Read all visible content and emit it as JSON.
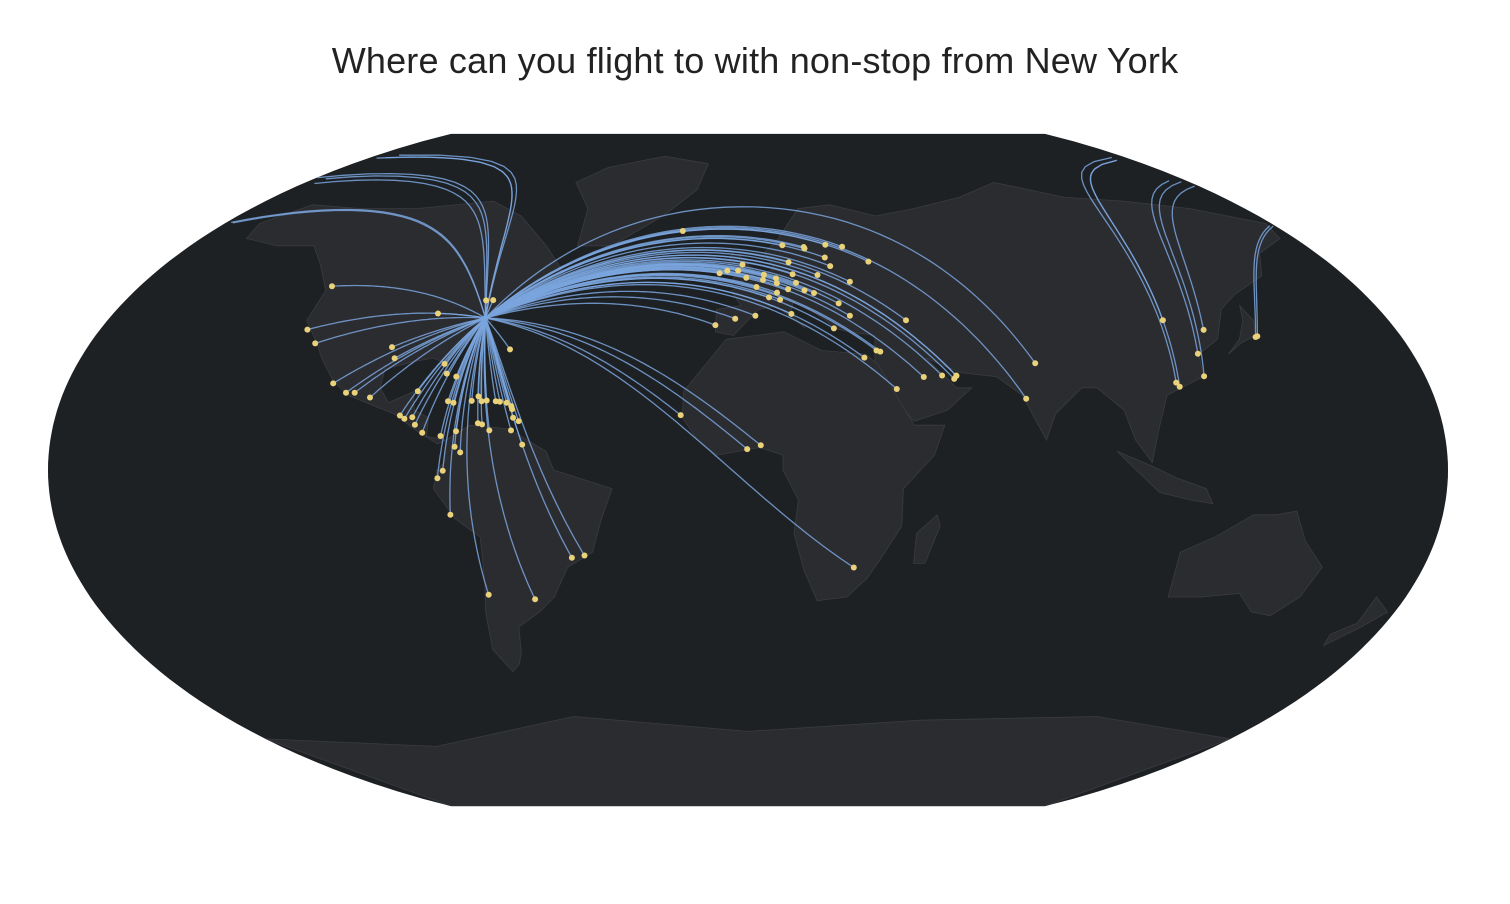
{
  "title": "Where can you flight to with non-stop from New York",
  "colors": {
    "background": "#ffffff",
    "ocean": "#1e2124",
    "land": "#2b2c30",
    "border": "#3a3b40",
    "route": "#7aa4dd",
    "destination": "#e9d27a",
    "title": "#222222"
  },
  "origin": {
    "lon": -74.0,
    "lat": 40.7
  },
  "destinations": [
    [
      -122.4,
      37.6
    ],
    [
      -118.4,
      33.9
    ],
    [
      -123.1,
      49.2
    ],
    [
      -97.0,
      32.9
    ],
    [
      -95.3,
      29.9
    ],
    [
      -87.9,
      41.9
    ],
    [
      -75.7,
      45.4
    ],
    [
      -73.7,
      45.5
    ],
    [
      -80.2,
      25.8
    ],
    [
      -81.4,
      28.4
    ],
    [
      -77.5,
      25.0
    ],
    [
      -64.7,
      32.3
    ],
    [
      -99.1,
      19.4
    ],
    [
      -86.9,
      21.1
    ],
    [
      -103.4,
      20.7
    ],
    [
      -105.7,
      20.7
    ],
    [
      -109.7,
      23.2
    ],
    [
      -90.5,
      14.6
    ],
    [
      -89.2,
      13.7
    ],
    [
      -87.2,
      14.1
    ],
    [
      -86.3,
      12.1
    ],
    [
      -84.2,
      10.0
    ],
    [
      -79.4,
      9.1
    ],
    [
      -77.0,
      18.0
    ],
    [
      -78.5,
      18.4
    ],
    [
      -72.3,
      18.5
    ],
    [
      -69.7,
      18.4
    ],
    [
      -70.7,
      19.7
    ],
    [
      -68.4,
      18.6
    ],
    [
      -66.0,
      18.4
    ],
    [
      -64.9,
      18.3
    ],
    [
      -63.1,
      18.0
    ],
    [
      -61.8,
      17.1
    ],
    [
      -61.5,
      16.3
    ],
    [
      -61.0,
      14.0
    ],
    [
      -59.5,
      13.1
    ],
    [
      -61.3,
      10.6
    ],
    [
      -70.0,
      12.5
    ],
    [
      -68.9,
      12.2
    ],
    [
      -75.5,
      10.4
    ],
    [
      -74.1,
      4.7
    ],
    [
      -75.6,
      6.2
    ],
    [
      -66.9,
      10.6
    ],
    [
      -58.2,
      6.8
    ],
    [
      -78.5,
      -0.2
    ],
    [
      -79.9,
      -2.2
    ],
    [
      -77.1,
      -12.0
    ],
    [
      -46.6,
      -23.5
    ],
    [
      -43.2,
      -22.9
    ],
    [
      -58.4,
      -34.6
    ],
    [
      -70.8,
      -33.4
    ],
    [
      -0.5,
      51.5
    ],
    [
      -6.3,
      53.4
    ],
    [
      -8.6,
      52.7
    ],
    [
      2.5,
      49.0
    ],
    [
      4.8,
      52.3
    ],
    [
      4.5,
      50.9
    ],
    [
      8.6,
      50.0
    ],
    [
      11.8,
      48.4
    ],
    [
      13.5,
      52.4
    ],
    [
      8.5,
      47.5
    ],
    [
      6.1,
      46.2
    ],
    [
      12.3,
      41.8
    ],
    [
      9.3,
      45.6
    ],
    [
      16.6,
      48.1
    ],
    [
      19.3,
      47.4
    ],
    [
      21.0,
      52.2
    ],
    [
      14.3,
      50.1
    ],
    [
      12.6,
      55.6
    ],
    [
      11.1,
      60.2
    ],
    [
      17.9,
      59.7
    ],
    [
      25.0,
      60.3
    ],
    [
      30.3,
      59.8
    ],
    [
      37.4,
      55.8
    ],
    [
      -3.6,
      40.5
    ],
    [
      2.1,
      41.3
    ],
    [
      -9.1,
      38.8
    ],
    [
      -21.9,
      64.0
    ],
    [
      28.8,
      41.3
    ],
    [
      23.9,
      37.9
    ],
    [
      26.1,
      44.6
    ],
    [
      30.4,
      50.4
    ],
    [
      34.9,
      32.0
    ],
    [
      35.9,
      31.7
    ],
    [
      31.4,
      30.1
    ],
    [
      46.7,
      24.9
    ],
    [
      39.2,
      21.7
    ],
    [
      51.6,
      25.3
    ],
    [
      54.7,
      24.4
    ],
    [
      55.4,
      25.3
    ],
    [
      55.4,
      25.2
    ],
    [
      44.4,
      40.1
    ],
    [
      77.1,
      28.6
    ],
    [
      72.9,
      19.1
    ],
    [
      116.6,
      40.1
    ],
    [
      121.8,
      31.1
    ],
    [
      113.3,
      23.4
    ],
    [
      113.9,
      22.3
    ],
    [
      121.2,
      25.1
    ],
    [
      126.5,
      37.5
    ],
    [
      139.8,
      35.6
    ],
    [
      140.4,
      35.8
    ],
    [
      -17.5,
      14.7
    ],
    [
      -0.2,
      5.6
    ],
    [
      3.3,
      6.6
    ],
    [
      28.2,
      -26.1
    ],
    [
      -3.0,
      53.4
    ],
    [
      8.4,
      51.3
    ],
    [
      -1.7,
      55.0
    ],
    [
      18.1,
      59.3
    ],
    [
      25.3,
      54.6
    ],
    [
      24.1,
      56.9
    ]
  ]
}
